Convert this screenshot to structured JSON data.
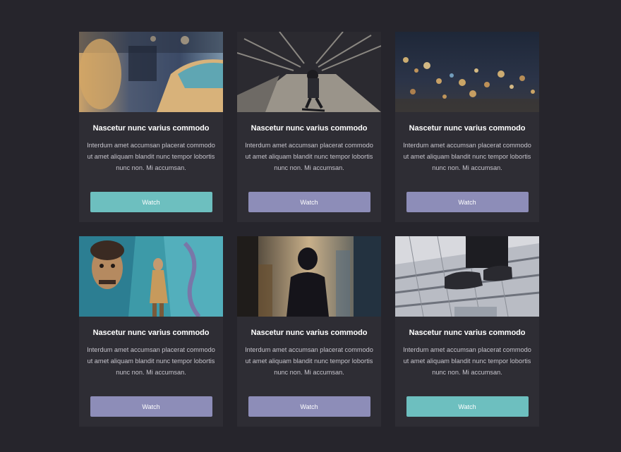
{
  "cards": [
    {
      "title": "Nascetur nunc varius commodo",
      "description": "Interdum amet accumsan placerat commodo ut amet aliquam blandit nunc tempor lobortis nunc non. Mi accumsan.",
      "button": "Watch",
      "button_color": "#6dbfbf",
      "image": "taxi-street-photo"
    },
    {
      "title": "Nascetur nunc varius commodo",
      "description": "Interdum amet accumsan placerat commodo ut amet aliquam blandit nunc tempor lobortis nunc non. Mi accumsan.",
      "button": "Watch",
      "button_color": "#8d8db8",
      "image": "skateboarder-photo"
    },
    {
      "title": "Nascetur nunc varius commodo",
      "description": "Interdum amet accumsan placerat commodo ut amet aliquam blandit nunc tempor lobortis nunc non. Mi accumsan.",
      "button": "Watch",
      "button_color": "#8d8db8",
      "image": "bokeh-city-lights-photo"
    },
    {
      "title": "Nascetur nunc varius commodo",
      "description": "Interdum amet accumsan placerat commodo ut amet aliquam blandit nunc tempor lobortis nunc non. Mi accumsan.",
      "button": "Watch",
      "button_color": "#8d8db8",
      "image": "graffiti-wall-photo"
    },
    {
      "title": "Nascetur nunc varius commodo",
      "description": "Interdum amet accumsan placerat commodo ut amet aliquam blandit nunc tempor lobortis nunc non. Mi accumsan.",
      "button": "Watch",
      "button_color": "#8d8db8",
      "image": "silhouette-street-photo"
    },
    {
      "title": "Nascetur nunc varius commodo",
      "description": "Interdum amet accumsan placerat commodo ut amet aliquam blandit nunc tempor lobortis nunc non. Mi accumsan.",
      "button": "Watch",
      "button_color": "#6dbfbf",
      "image": "sneakers-stairs-photo"
    }
  ]
}
